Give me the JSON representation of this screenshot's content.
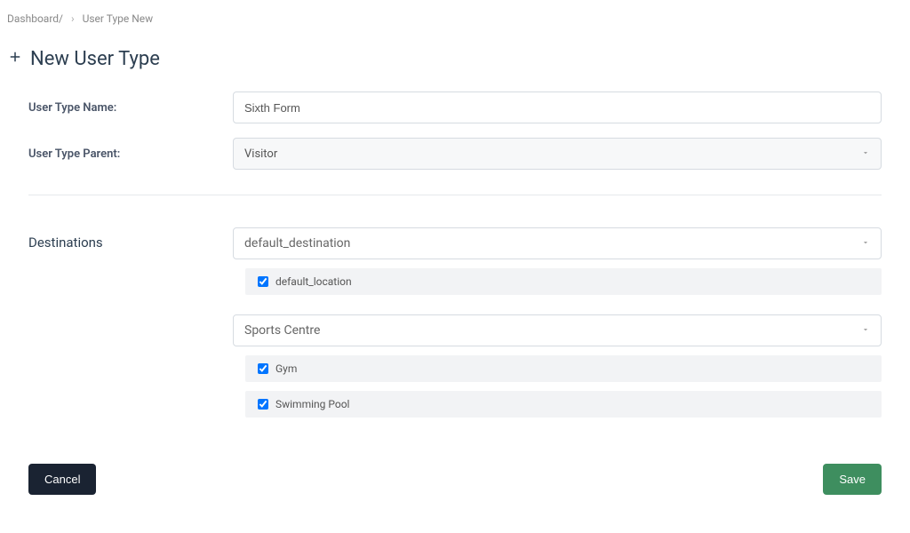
{
  "breadcrumb": {
    "root": "Dashboard/",
    "current": "User Type New"
  },
  "page_title": "New User Type",
  "form": {
    "name_label": "User Type Name:",
    "name_value": "Sixth Form",
    "parent_label": "User Type Parent:",
    "parent_value": "Visitor"
  },
  "destinations": {
    "label": "Destinations",
    "groups": [
      {
        "name": "default_destination",
        "locations": [
          {
            "label": "default_location",
            "checked": true
          }
        ]
      },
      {
        "name": "Sports Centre",
        "locations": [
          {
            "label": "Gym",
            "checked": true
          },
          {
            "label": "Swimming Pool",
            "checked": true
          }
        ]
      }
    ]
  },
  "buttons": {
    "cancel": "Cancel",
    "save": "Save"
  }
}
